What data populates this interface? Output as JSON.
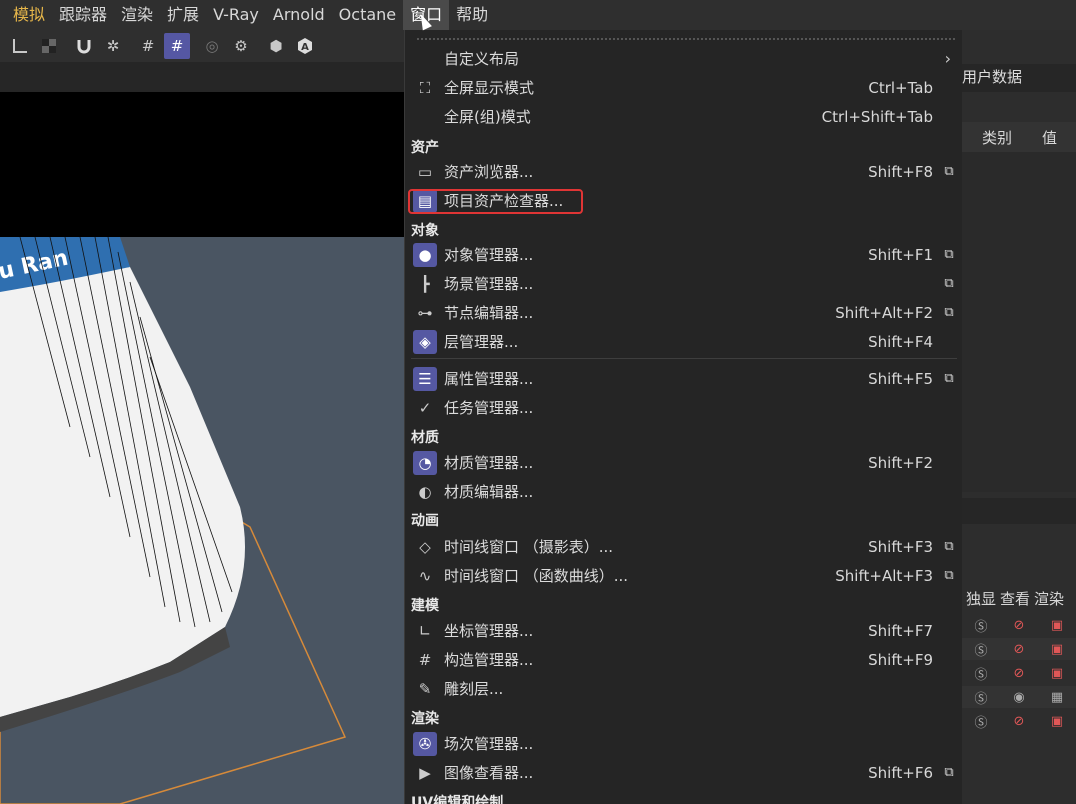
{
  "menubar": {
    "items": [
      "模拟",
      "跟踪器",
      "渲染",
      "扩展",
      "V-Ray",
      "Arnold",
      "Octane",
      "窗口",
      "帮助"
    ],
    "active": "窗口"
  },
  "toolbar": {
    "icons": [
      "axis-icon",
      "checker-icon",
      "magnet-icon",
      "snap-gear-icon",
      "grid-icon",
      "grid-a-icon",
      "target-icon",
      "settings-circle-icon",
      "hex-icon",
      "a-hex-icon"
    ]
  },
  "viewport": {
    "logo_text": "u Ran"
  },
  "right_panel": {
    "user_data": "用户数据",
    "col_type": "类别",
    "col_value": "值",
    "layer_cols": [
      "独显",
      "查看",
      "渲染"
    ]
  },
  "menu": {
    "items": [
      {
        "label": "自定义布局",
        "shortcut": "",
        "submenu": true,
        "icon": ""
      },
      {
        "label": "全屏显示模式",
        "shortcut": "Ctrl+Tab",
        "icon": "fullscreen-icon"
      },
      {
        "label": "全屏(组)模式",
        "shortcut": "Ctrl+Shift+Tab",
        "icon": ""
      },
      {
        "section": "资产"
      },
      {
        "label": "资产浏览器...",
        "shortcut": "Shift+F8",
        "ext": true,
        "icon": "asset-browser-icon"
      },
      {
        "label": "项目资产检查器...",
        "shortcut": "",
        "icon": "project-asset-icon",
        "bg": true,
        "highlight": true
      },
      {
        "section": "对象"
      },
      {
        "label": "对象管理器...",
        "shortcut": "Shift+F1",
        "ext": true,
        "icon": "object-manager-icon",
        "bg": true
      },
      {
        "label": "场景管理器...",
        "shortcut": "",
        "ext": true,
        "icon": "scene-tree-icon"
      },
      {
        "label": "节点编辑器...",
        "shortcut": "Shift+Alt+F2",
        "ext": true,
        "icon": "node-editor-icon"
      },
      {
        "label": "层管理器...",
        "shortcut": "Shift+F4",
        "icon": "layer-icon",
        "bg": true
      },
      {
        "divider": true
      },
      {
        "label": "属性管理器...",
        "shortcut": "Shift+F5",
        "ext": true,
        "icon": "attribute-icon",
        "bg": true
      },
      {
        "label": "任务管理器...",
        "shortcut": "",
        "icon": "task-icon"
      },
      {
        "section": "材质"
      },
      {
        "label": "材质管理器...",
        "shortcut": "Shift+F2",
        "icon": "material-manager-icon",
        "bg": true
      },
      {
        "label": "材质编辑器...",
        "shortcut": "",
        "icon": "material-editor-icon"
      },
      {
        "section": "动画"
      },
      {
        "label": "时间线窗口 （摄影表）...",
        "shortcut": "Shift+F3",
        "ext": true,
        "icon": "keyframe-icon"
      },
      {
        "label": "时间线窗口 （函数曲线）...",
        "shortcut": "Shift+Alt+F3",
        "ext": true,
        "icon": "fcurve-icon"
      },
      {
        "section": "建模"
      },
      {
        "label": "坐标管理器...",
        "shortcut": "Shift+F7",
        "icon": "coordinate-icon"
      },
      {
        "label": "构造管理器...",
        "shortcut": "Shift+F9",
        "icon": "construct-icon"
      },
      {
        "label": "雕刻层...",
        "shortcut": "",
        "icon": "sculpt-icon"
      },
      {
        "section": "渲染"
      },
      {
        "label": "场次管理器...",
        "shortcut": "",
        "icon": "take-manager-icon",
        "bg": true
      },
      {
        "label": "图像查看器...",
        "shortcut": "Shift+F6",
        "ext": true,
        "icon": "picture-viewer-icon"
      },
      {
        "section": "UV编辑和绘制"
      }
    ]
  }
}
